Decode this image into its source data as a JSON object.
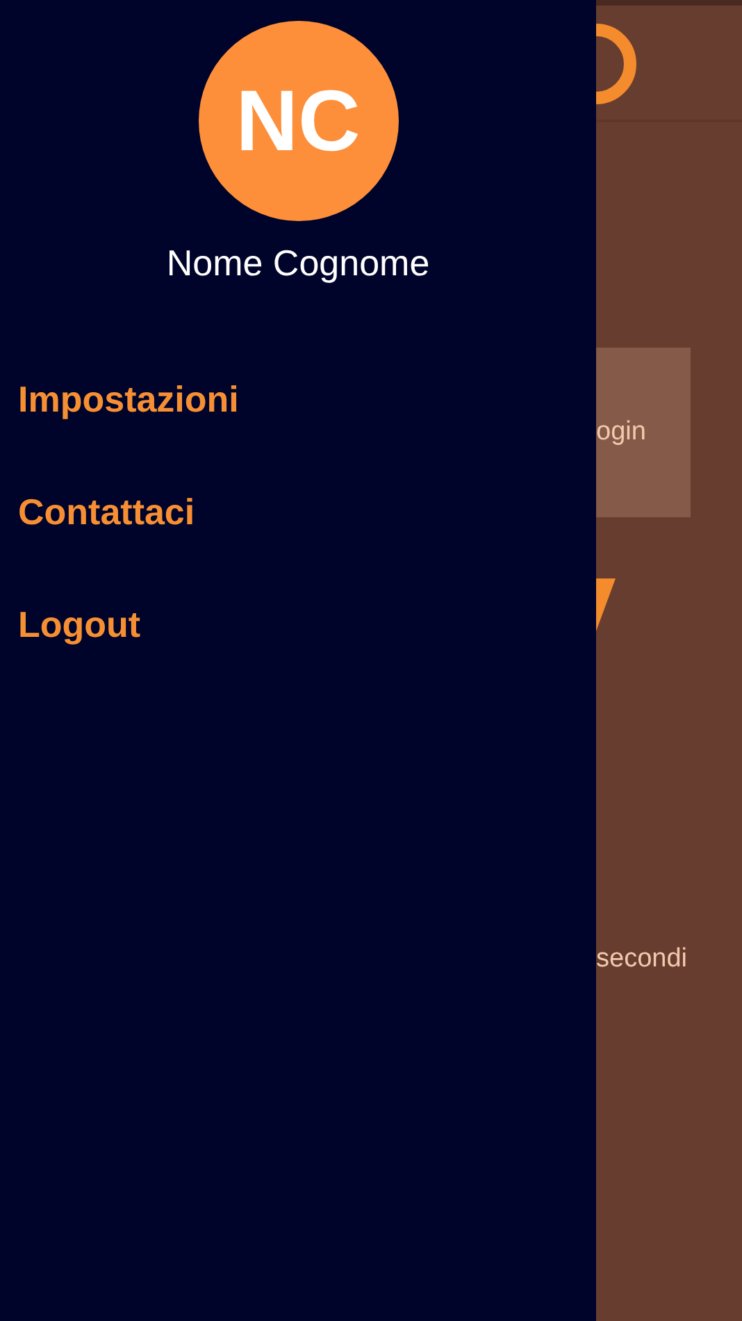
{
  "drawer": {
    "avatar": {
      "initials": "NC"
    },
    "user_name": "Nome Cognome",
    "menu": [
      {
        "label": "Impostazioni"
      },
      {
        "label": "Contattaci"
      },
      {
        "label": "Logout"
      }
    ]
  },
  "background_screen": {
    "button": {
      "label": "ogin"
    },
    "text": "secondi"
  }
}
